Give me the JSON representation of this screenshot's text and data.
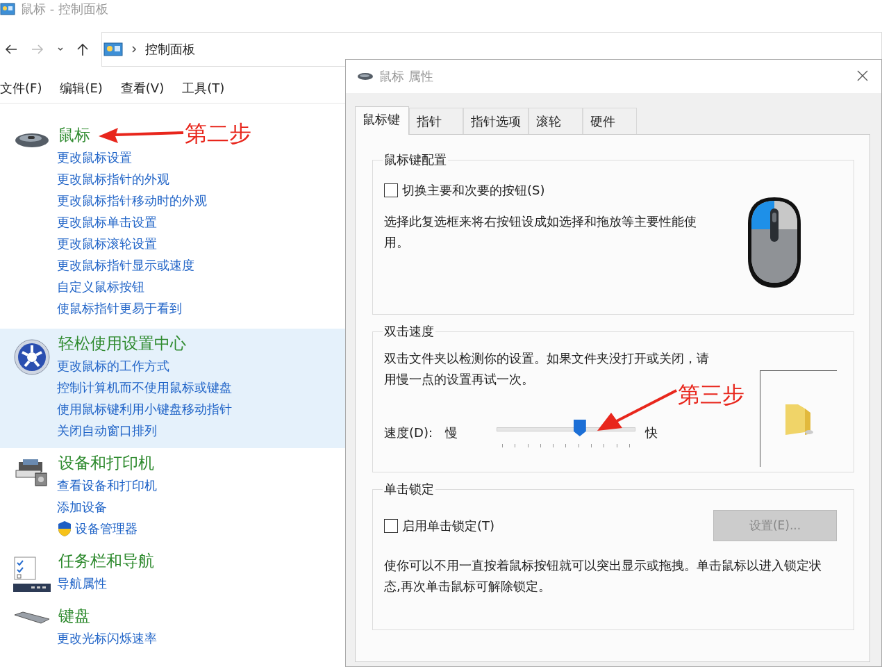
{
  "window": {
    "title": "鼠标 - 控制面板"
  },
  "address_bar": {
    "crumbs": [
      "控制面板"
    ]
  },
  "menu": [
    "文件(F)",
    "编辑(E)",
    "查看(V)",
    "工具(T)"
  ],
  "categories": [
    {
      "kind": "mouse",
      "title": "鼠标",
      "highlighted": false,
      "links": [
        {
          "text": "更改鼠标设置",
          "shield": false
        },
        {
          "text": "更改鼠标指针的外观",
          "shield": false
        },
        {
          "text": "更改鼠标指针移动时的外观",
          "shield": false
        },
        {
          "text": "更改鼠标单击设置",
          "shield": false
        },
        {
          "text": "更改鼠标滚轮设置",
          "shield": false
        },
        {
          "text": "更改鼠标指针显示或速度",
          "shield": false
        },
        {
          "text": "自定义鼠标按钮",
          "shield": false
        },
        {
          "text": "使鼠标指针更易于看到",
          "shield": false
        }
      ]
    },
    {
      "kind": "ease",
      "title": "轻松使用设置中心",
      "highlighted": true,
      "links": [
        {
          "text": "更改鼠标的工作方式",
          "shield": false
        },
        {
          "text": "控制计算机而不使用鼠标或键盘",
          "shield": false
        },
        {
          "text": "使用鼠标键利用小键盘移动指针",
          "shield": false
        },
        {
          "text": "关闭自动窗口排列",
          "shield": false
        }
      ]
    },
    {
      "kind": "printer",
      "title": "设备和打印机",
      "highlighted": false,
      "links": [
        {
          "text": "查看设备和打印机",
          "shield": false
        },
        {
          "text": "添加设备",
          "shield": false
        },
        {
          "text": "设备管理器",
          "shield": true
        }
      ]
    },
    {
      "kind": "taskbar",
      "title": "任务栏和导航",
      "highlighted": false,
      "links": [
        {
          "text": "导航属性",
          "shield": false
        }
      ]
    },
    {
      "kind": "keyboard",
      "title": "键盘",
      "highlighted": false,
      "links": [
        {
          "text": "更改光标闪烁速率",
          "shield": false
        }
      ]
    }
  ],
  "dialog": {
    "title": "鼠标 属性",
    "tabs": [
      {
        "label": "鼠标键",
        "selected": true
      },
      {
        "label": "指针",
        "selected": false
      },
      {
        "label": "指针选项",
        "selected": false
      },
      {
        "label": "滚轮",
        "selected": false
      },
      {
        "label": "硬件",
        "selected": false
      }
    ],
    "button_config": {
      "legend": "鼠标键配置",
      "checkbox": {
        "label": "切换主要和次要的按钮(S)",
        "checked": false
      },
      "description": "选择此复选框来将右按钮设成如选择和拖放等主要性能使用。"
    },
    "double_click": {
      "legend": "双击速度",
      "description": "双击文件夹以检测你的设置。如果文件夹没打开或关闭，请用慢一点的设置再试一次。",
      "speed_label": "速度(D):",
      "slow": "慢",
      "fast": "快",
      "level": 0.6
    },
    "click_lock": {
      "legend": "单击锁定",
      "checkbox": {
        "label": "启用单击锁定(T)",
        "checked": false
      },
      "button": {
        "label": "设置(E)...",
        "disabled": true
      },
      "description": "使你可以不用一直按着鼠标按钮就可以突出显示或拖拽。单击鼠标以进入锁定状态,再次单击鼠标可解除锁定。"
    }
  },
  "annotations": [
    {
      "text": "第二步"
    },
    {
      "text": "第三步"
    }
  ]
}
